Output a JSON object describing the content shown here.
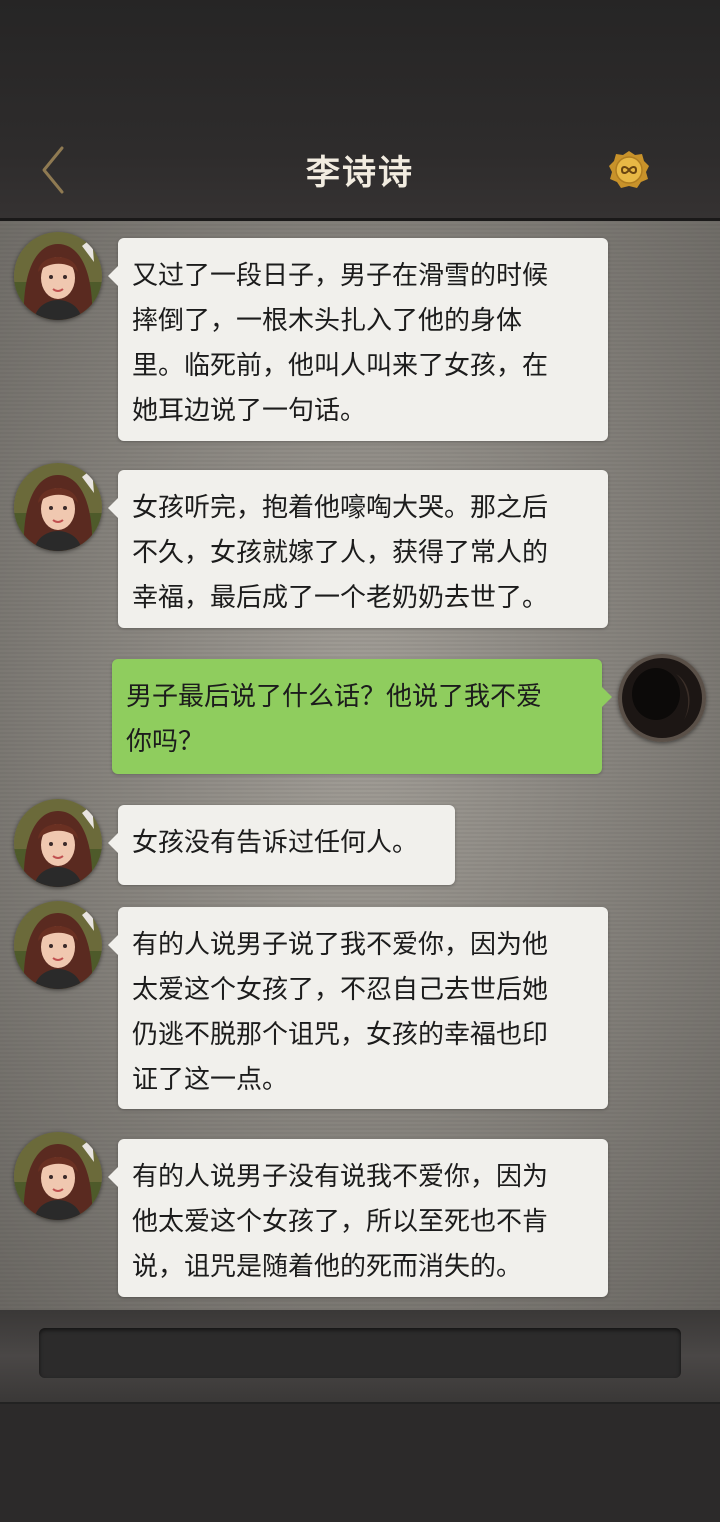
{
  "header": {
    "title": "李诗诗",
    "back_icon": "chevron-left-icon",
    "coin_icon": "infinity-coin-icon"
  },
  "messages": [
    {
      "side": "left",
      "text_lines": [
        "又过了一段日子，男子在滑雪的时候",
        "摔倒了，一根木头扎入了他的身体",
        "里。临死前，他叫人叫来了女孩，在",
        "她耳边说了一句话。"
      ]
    },
    {
      "side": "left",
      "text_lines": [
        "女孩听完，抱着他嚎啕大哭。那之后",
        "不久，女孩就嫁了人，获得了常人的",
        "幸福，最后成了一个老奶奶去世了。"
      ]
    },
    {
      "side": "right",
      "text_lines": [
        "男子最后说了什么话？他说了我不爱",
        "你吗？"
      ]
    },
    {
      "side": "left",
      "text_lines": [
        "女孩没有告诉过任何人。"
      ]
    },
    {
      "side": "left",
      "text_lines": [
        "有的人说男子说了我不爱你，因为他",
        "太爱这个女孩了，不忍自己去世后她",
        "仍逃不脱那个诅咒，女孩的幸福也印",
        "证了这一点。"
      ]
    },
    {
      "side": "left",
      "text_lines": [
        "有的人说男子没有说我不爱你，因为",
        "他太爱这个女孩了，所以至死也不肯",
        "说，诅咒是随着他的死而消失的。"
      ]
    }
  ],
  "colors": {
    "header_bg": "#2e2c2c",
    "title_text": "#f2ece0",
    "left_bubble": "#f1f0ec",
    "right_bubble": "#8fcd5e",
    "chat_bg": "#a19d96"
  }
}
